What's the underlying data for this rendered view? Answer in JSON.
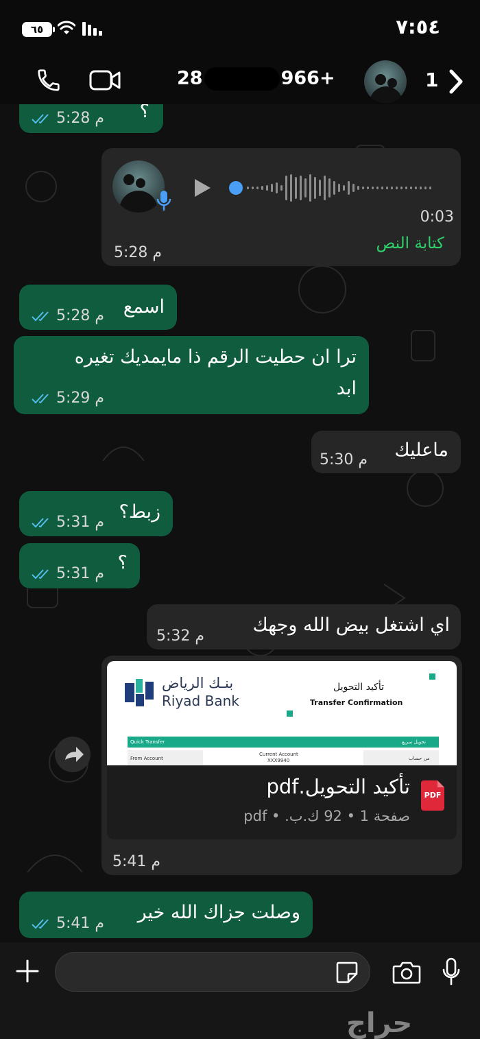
{
  "status_bar": {
    "time": "٧:٥٤",
    "battery": "٦٥"
  },
  "header": {
    "name_prefix": "28",
    "name_suffix": "966+",
    "unread_count": "1"
  },
  "messages": [
    {
      "direction": "out",
      "text": "؟",
      "time": "5:28 م"
    },
    {
      "direction": "in",
      "type": "voice",
      "duration": "0:03",
      "transcribe_label": "كتابة النص",
      "time": "5:28 م"
    },
    {
      "direction": "out",
      "text": "اسمع",
      "time": "5:28 م"
    },
    {
      "direction": "out",
      "text_line1": "ترا ان حطيت الرقم ذا مايمديك تغيره",
      "text_line2": "ابد",
      "time": "5:29 م"
    },
    {
      "direction": "in",
      "text": "ماعليك",
      "time": "5:30 م"
    },
    {
      "direction": "out",
      "text": "زبط؟",
      "time": "5:31 م"
    },
    {
      "direction": "out",
      "text": "؟",
      "time": "5:31 م"
    },
    {
      "direction": "in",
      "text": "اي اشتغل بيض الله وجهك",
      "time": "5:32 م"
    },
    {
      "direction": "in",
      "type": "document",
      "file_name": "تأكيد التحويل.pdf",
      "file_info": "صفحة 1 • 92 ك.ب. • pdf",
      "icon_label": "PDF",
      "time": "5:41 م",
      "preview": {
        "bank_name_ar": "بنـك الرياض",
        "bank_name_en": "Riyad Bank",
        "title_ar": "تأكيد التحويل",
        "title_en": "Transfer Confirmation",
        "quick_transfer_en": "Quick Transfer",
        "quick_transfer_ar": "تحويل سريع",
        "from_account_en": "From Account",
        "from_account_ar": "من حساب",
        "current_account": "Current Account",
        "account_mask": "XXX9940"
      }
    },
    {
      "direction": "out",
      "text": "وصلت جزاك الله خير",
      "time": "5:41 م"
    }
  ],
  "watermark": "حراج",
  "colors": {
    "out_bubble": "#0f5c3f",
    "in_bubble": "#262626",
    "accent_green": "#2fd16b",
    "tick_blue": "#53bdeb"
  }
}
